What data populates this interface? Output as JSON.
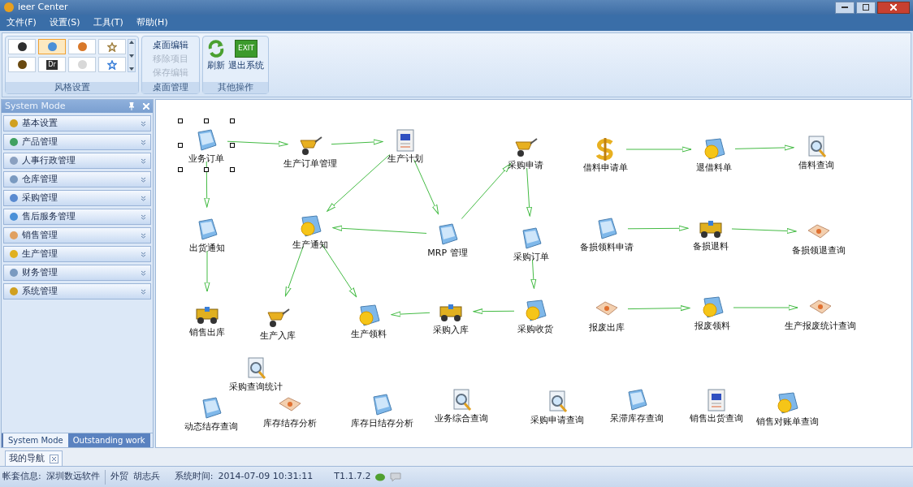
{
  "window": {
    "title": "ieer Center"
  },
  "menu": [
    "文件(F)",
    "设置(S)",
    "工具(T)",
    "帮助(H)"
  ],
  "ribbon": {
    "style_group": {
      "title": "风格设置",
      "items": [
        {
          "kind": "orb",
          "color": "#2f2f2f",
          "selected": false
        },
        {
          "kind": "orb",
          "color": "#4a8fd8",
          "selected": true
        },
        {
          "kind": "orb",
          "color": "#d8782a",
          "selected": false
        },
        {
          "kind": "star",
          "color": "#a08040",
          "selected": false
        },
        {
          "kind": "orb",
          "color": "#6a4a10",
          "selected": false
        },
        {
          "kind": "label",
          "label": "Dr",
          "color": "#303030",
          "selected": false
        },
        {
          "kind": "orb",
          "color": "#d8d8d8",
          "selected": false
        },
        {
          "kind": "star",
          "color": "#3a7fd8",
          "selected": false
        }
      ]
    },
    "desktop_group": {
      "title": "桌面管理",
      "items": [
        {
          "label": "桌面编辑",
          "disabled": false
        },
        {
          "label": "移除项目",
          "disabled": true
        },
        {
          "label": "保存编辑",
          "disabled": true
        }
      ]
    },
    "other_group": {
      "title": "其他操作",
      "items": [
        {
          "kind": "refresh",
          "label": "刷新"
        },
        {
          "kind": "exit",
          "label": "退出系统",
          "icon_text": "EXIT"
        }
      ]
    }
  },
  "sidebar": {
    "title": "System Mode",
    "items": [
      "基本设置",
      "产品管理",
      "人事行政管理",
      "仓库管理",
      "采购管理",
      "售后服务管理",
      "销售管理",
      "生产管理",
      "财务管理",
      "系统管理"
    ],
    "tabs": [
      {
        "label": "System Mode",
        "selected": true
      },
      {
        "label": "Outstanding work",
        "selected": false
      }
    ]
  },
  "diagram": {
    "nodes": [
      {
        "label": "业务订单",
        "selected": true
      },
      {
        "label": "生产订单管理",
        "selected": false
      },
      {
        "label": "生产计划",
        "selected": false
      },
      {
        "label": "采购申请",
        "selected": false
      },
      {
        "label": "借料申请单",
        "selected": false
      },
      {
        "label": "退借料单",
        "selected": false
      },
      {
        "label": "借料查询",
        "selected": false
      },
      {
        "label": "出货通知",
        "selected": false
      },
      {
        "label": "生产通知",
        "selected": false
      },
      {
        "label": "MRP 管理",
        "selected": false
      },
      {
        "label": "采购订单",
        "selected": false
      },
      {
        "label": "备损领料申请",
        "selected": false
      },
      {
        "label": "备损退料",
        "selected": false
      },
      {
        "label": "备损领退查询",
        "selected": false
      },
      {
        "label": "销售出库",
        "selected": false
      },
      {
        "label": "生产入库",
        "selected": false
      },
      {
        "label": "生产领料",
        "selected": false
      },
      {
        "label": "采购入库",
        "selected": false
      },
      {
        "label": "采购收货",
        "selected": false
      },
      {
        "label": "报废出库",
        "selected": false
      },
      {
        "label": "报废领料",
        "selected": false
      },
      {
        "label": "生产报废统计查询",
        "selected": false
      },
      {
        "label": "采购查询统计",
        "selected": false
      },
      {
        "label": "动态结存查询",
        "selected": false
      },
      {
        "label": "库存结存分析",
        "selected": false
      },
      {
        "label": "库存日结存分析",
        "selected": false
      },
      {
        "label": "业务综合查询",
        "selected": false
      },
      {
        "label": "采购申请查询",
        "selected": false
      },
      {
        "label": "呆滞库存查询",
        "selected": false
      },
      {
        "label": "销售出货查询",
        "selected": false
      },
      {
        "label": "销售对账单查询",
        "selected": false
      }
    ]
  },
  "document_tabs": [
    {
      "label": "我的导航",
      "selected": true
    }
  ],
  "status_bar": {
    "account_label": "帐套信息:",
    "account": "深圳数远软件",
    "department": "外贸",
    "user": "胡志兵",
    "time_label": "系统时间:",
    "time": "2014-07-09 10:31:11",
    "version": "T1.1.7.2"
  }
}
